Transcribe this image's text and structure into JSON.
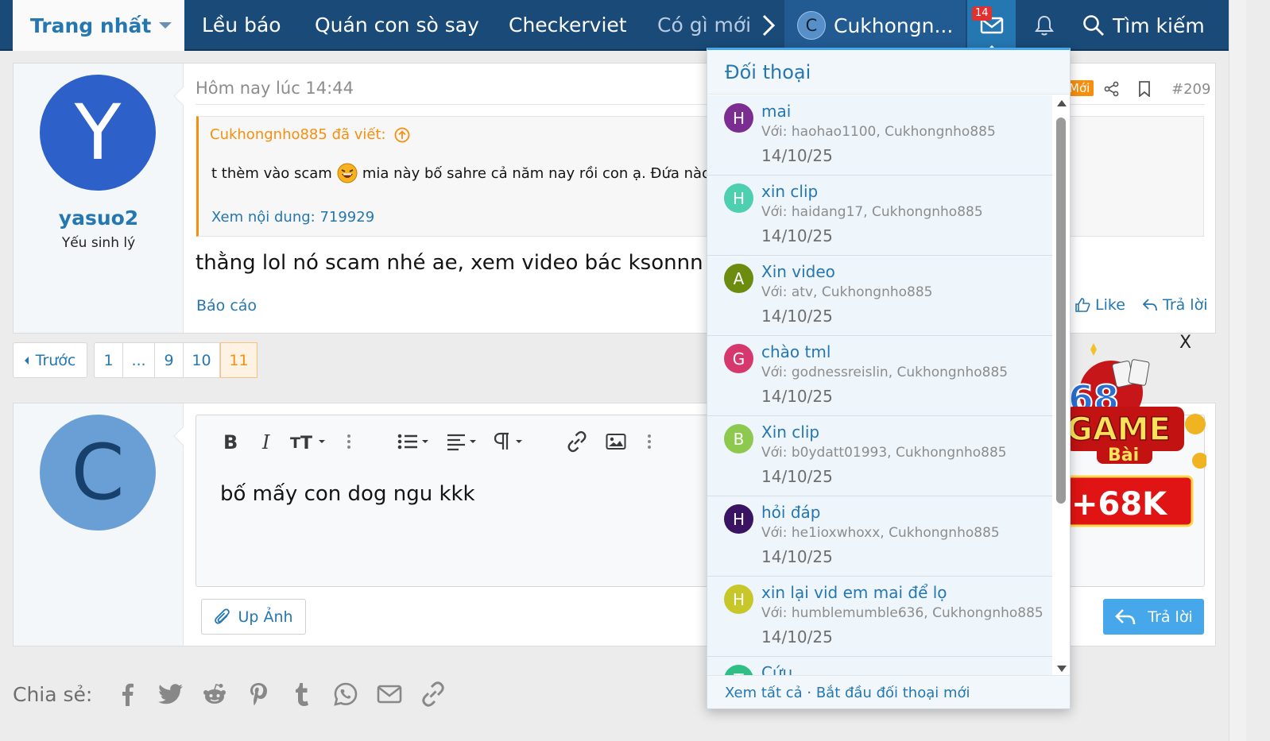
{
  "nav": {
    "home": "Trang nhất",
    "links": [
      "Lều báo",
      "Quán con sò say",
      "Checkerviet",
      "Có gì mới"
    ],
    "user_initial": "C",
    "user_name": "Cukhongn...",
    "inbox_count": "14",
    "search": "Tìm kiếm",
    "colors": {
      "bar": "#1a4a78",
      "accent": "#2577b1"
    }
  },
  "post": {
    "avatar_initial": "Y",
    "username": "yasuo2",
    "user_title": "Yếu sinh lý",
    "date": "Hôm nay lúc 14:44",
    "new_tag": "Mới",
    "number": "#209",
    "quote": {
      "author": "Cukhongnho885 đã viết:",
      "text_before": "t thèm vào scam",
      "text_after": "mia này bố sahre cả năm nay rồi con ạ. Đứa nào xe",
      "expand": "Xem nội dung: 719929"
    },
    "body": "thằng lol nó scam nhé ae, xem video bác ksonnn gửi t",
    "report": "Báo cáo",
    "like": "Like",
    "reply": "Trả lời"
  },
  "pagination": {
    "prev": "Trước",
    "pages": [
      "1",
      "...",
      "9",
      "10",
      "11"
    ],
    "current": "11"
  },
  "reply_box": {
    "avatar_initial": "C",
    "text": "bố mấy con dog ngu kkk",
    "upload": "Up Ảnh",
    "submit": "Trả lời"
  },
  "ad": {
    "close": "X"
  },
  "share": {
    "label": "Chia sẻ:",
    "icons": [
      "facebook-icon",
      "twitter-icon",
      "reddit-icon",
      "pinterest-icon",
      "tumblr-icon",
      "whatsapp-icon",
      "email-icon",
      "link-icon"
    ]
  },
  "conversations": {
    "title": "Đối thoại",
    "items": [
      {
        "initial": "H",
        "color": "#7b2d91",
        "title": "mai",
        "with": "Với: haohao1100, Cukhongnho885",
        "date": "14/10/25"
      },
      {
        "initial": "H",
        "color": "#4dcfb0",
        "title": "xin clip",
        "with": "Với: haidang17, Cukhongnho885",
        "date": "14/10/25"
      },
      {
        "initial": "A",
        "color": "#6b8c0f",
        "title": "Xin video",
        "with": "Với: atv, Cukhongnho885",
        "date": "14/10/25"
      },
      {
        "initial": "G",
        "color": "#d6386d",
        "title": "chào tml",
        "with": "Với: godnessreislin, Cukhongnho885",
        "date": "14/10/25"
      },
      {
        "initial": "B",
        "color": "#8ec94f",
        "title": "Xin clip",
        "with": "Với: b0ydatt01993, Cukhongnho885",
        "date": "14/10/25"
      },
      {
        "initial": "H",
        "color": "#3a1462",
        "title": "hỏi đáp",
        "with": "Với: he1ioxwhoxx, Cukhongnho885",
        "date": "14/10/25"
      },
      {
        "initial": "H",
        "color": "#c7c72a",
        "title": "xin lại vid em mai để lọ",
        "with": "Với: humblemumble636, Cukhongnho885",
        "date": "14/10/25"
      },
      {
        "initial": "T",
        "color": "#2fbf84",
        "title": "Cứu",
        "with": "",
        "date": ""
      }
    ],
    "footer_all": "Xem tất cả",
    "footer_sep": " · ",
    "footer_new": "Bắt đầu đối thoại mới"
  }
}
